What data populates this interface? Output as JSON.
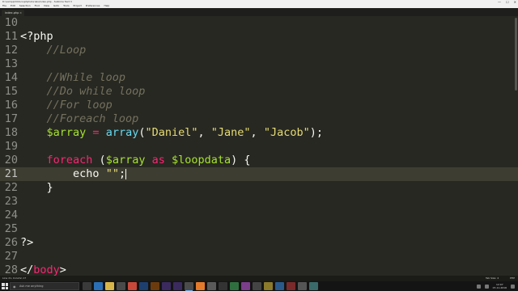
{
  "window": {
    "title": "D:\\xampp\\htdocs\\phptutorials\\index.php - Sublime Text 3",
    "controls": {
      "minimize": "—",
      "maximize": "☐",
      "close": "✕"
    }
  },
  "menu": [
    "File",
    "Edit",
    "Selection",
    "Find",
    "View",
    "Goto",
    "Tools",
    "Project",
    "Preferences",
    "Help"
  ],
  "tab": {
    "label": "index.php",
    "close": "×"
  },
  "editor": {
    "active_line": 21,
    "lines": [
      {
        "num": "10",
        "segments": []
      },
      {
        "num": "11",
        "segments": [
          {
            "t": "<?php",
            "c": "plain"
          }
        ]
      },
      {
        "num": "12",
        "segments": [
          {
            "t": "    ",
            "c": "plain"
          },
          {
            "t": "//Loop",
            "c": "comment"
          }
        ]
      },
      {
        "num": "13",
        "segments": []
      },
      {
        "num": "14",
        "segments": [
          {
            "t": "    ",
            "c": "plain"
          },
          {
            "t": "//While loop",
            "c": "comment"
          }
        ]
      },
      {
        "num": "15",
        "segments": [
          {
            "t": "    ",
            "c": "plain"
          },
          {
            "t": "//Do while loop",
            "c": "comment"
          }
        ]
      },
      {
        "num": "16",
        "segments": [
          {
            "t": "    ",
            "c": "plain"
          },
          {
            "t": "//For loop",
            "c": "comment"
          }
        ]
      },
      {
        "num": "17",
        "segments": [
          {
            "t": "    ",
            "c": "plain"
          },
          {
            "t": "//Foreach loop",
            "c": "comment"
          }
        ]
      },
      {
        "num": "18",
        "segments": [
          {
            "t": "    ",
            "c": "plain"
          },
          {
            "t": "$array",
            "c": "var"
          },
          {
            "t": " = ",
            "c": "kw"
          },
          {
            "t": "array",
            "c": "fn"
          },
          {
            "t": "(",
            "c": "plain"
          },
          {
            "t": "\"Daniel\"",
            "c": "str"
          },
          {
            "t": ", ",
            "c": "plain"
          },
          {
            "t": "\"Jane\"",
            "c": "str"
          },
          {
            "t": ", ",
            "c": "plain"
          },
          {
            "t": "\"Jacob\"",
            "c": "str"
          },
          {
            "t": ");",
            "c": "plain"
          }
        ]
      },
      {
        "num": "19",
        "segments": []
      },
      {
        "num": "20",
        "segments": [
          {
            "t": "    ",
            "c": "plain"
          },
          {
            "t": "foreach",
            "c": "kw"
          },
          {
            "t": " (",
            "c": "plain"
          },
          {
            "t": "$array",
            "c": "var"
          },
          {
            "t": " as ",
            "c": "kw"
          },
          {
            "t": "$loopdata",
            "c": "var"
          },
          {
            "t": ") {",
            "c": "plain"
          }
        ]
      },
      {
        "num": "21",
        "segments": [
          {
            "t": "        ",
            "c": "plain"
          },
          {
            "t": "echo",
            "c": "plain"
          },
          {
            "t": " ",
            "c": "plain"
          },
          {
            "t": "\"\"",
            "c": "str"
          },
          {
            "t": ";",
            "c": "plain"
          }
        ],
        "cursor": true
      },
      {
        "num": "22",
        "segments": [
          {
            "t": "    ",
            "c": "plain"
          },
          {
            "t": "}",
            "c": "plain"
          }
        ]
      },
      {
        "num": "23",
        "segments": []
      },
      {
        "num": "24",
        "segments": []
      },
      {
        "num": "25",
        "segments": []
      },
      {
        "num": "26",
        "segments": [
          {
            "t": "?>",
            "c": "plain"
          }
        ]
      },
      {
        "num": "27",
        "segments": []
      },
      {
        "num": "28",
        "segments": [
          {
            "t": "</",
            "c": "plain"
          },
          {
            "t": "body",
            "c": "kw"
          },
          {
            "t": ">",
            "c": "plain"
          }
        ]
      }
    ]
  },
  "status": {
    "left": "Line 21, Column 17",
    "tab_size": "Tab Size: 4",
    "syntax": "PHP"
  },
  "taskbar": {
    "search_placeholder": "Ask me anything",
    "time": "12:07",
    "date": "07-11-2016",
    "apps": [
      {
        "name": "task-view",
        "color": "#3a3a3a"
      },
      {
        "name": "edge",
        "color": "#2a6fb5"
      },
      {
        "name": "file-explorer",
        "color": "#d9b64a"
      },
      {
        "name": "store",
        "color": "#4a4a4a"
      },
      {
        "name": "chrome",
        "color": "#c9483a"
      },
      {
        "name": "photoshop",
        "color": "#1d3f6e"
      },
      {
        "name": "illustrator",
        "color": "#6b3b0e"
      },
      {
        "name": "aftereffects",
        "color": "#3b2a5e"
      },
      {
        "name": "premiere",
        "color": "#3b2a5e"
      },
      {
        "name": "sublime",
        "color": "#4b4b4b",
        "active": true
      },
      {
        "name": "xampp",
        "color": "#e37a2c"
      },
      {
        "name": "obs",
        "color": "#5a5a5a"
      },
      {
        "name": "cmd",
        "color": "#333333"
      },
      {
        "name": "app-14",
        "color": "#2f6f3f"
      },
      {
        "name": "app-15",
        "color": "#7a3e8a"
      },
      {
        "name": "app-16",
        "color": "#444444"
      },
      {
        "name": "app-17",
        "color": "#8a7a2a"
      },
      {
        "name": "app-18",
        "color": "#2a5a8a"
      },
      {
        "name": "app-19",
        "color": "#7a2a2a"
      },
      {
        "name": "app-20",
        "color": "#555555"
      },
      {
        "name": "app-21",
        "color": "#3a6a6a"
      }
    ]
  }
}
